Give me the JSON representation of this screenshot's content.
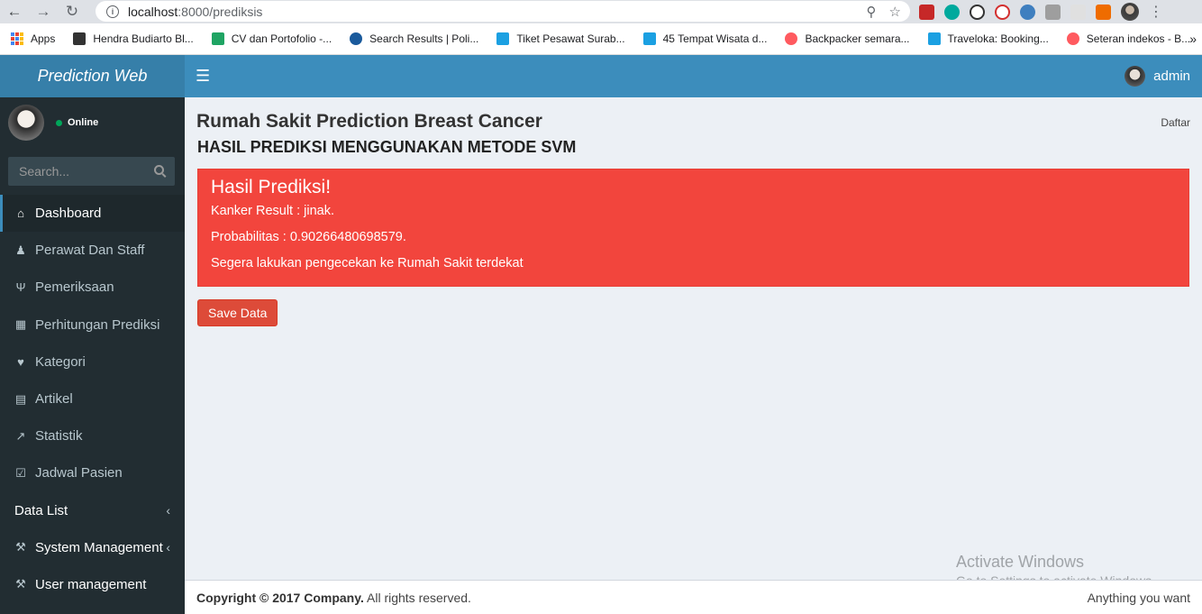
{
  "browser": {
    "url_host": "localhost",
    "url_rest": ":8000/prediksis",
    "bookmarks": [
      {
        "label": "Apps",
        "color": "#4285f4"
      },
      {
        "label": "Hendra Budiarto Bl...",
        "color": "#333333"
      },
      {
        "label": "CV dan Portofolio -...",
        "color": "#1fa463"
      },
      {
        "label": "Search Results | Poli...",
        "color": "#1a5a9c"
      },
      {
        "label": "Tiket Pesawat Surab...",
        "color": "#1ba0e2"
      },
      {
        "label": "45 Tempat Wisata d...",
        "color": "#1ba0e2"
      },
      {
        "label": "Backpacker semara...",
        "color": "#ff5a5f"
      },
      {
        "label": "Traveloka: Booking...",
        "color": "#1ba0e2"
      },
      {
        "label": "Seteran indekos - B...",
        "color": "#ff5a5f"
      }
    ],
    "more_label": "»"
  },
  "header": {
    "brand": "Prediction Web",
    "username": "admin"
  },
  "sidebar": {
    "status": "Online",
    "search_placeholder": "Search...",
    "items": [
      {
        "label": "Dashboard",
        "icon": "home-icon"
      },
      {
        "label": "Perawat Dan Staff",
        "icon": "user-icon"
      },
      {
        "label": "Pemeriksaan",
        "icon": "stethoscope-icon"
      },
      {
        "label": "Perhitungan Prediksi",
        "icon": "calculator-icon"
      },
      {
        "label": "Kategori",
        "icon": "heartbeat-icon"
      },
      {
        "label": "Artikel",
        "icon": "file-icon"
      },
      {
        "label": "Statistik",
        "icon": "line-chart-icon"
      },
      {
        "label": "Jadwal Pasien",
        "icon": "calendar-check-icon"
      },
      {
        "label": "Data List",
        "icon": ""
      },
      {
        "label": "System Management",
        "icon": "wrench-icon"
      },
      {
        "label": "User management",
        "icon": "wrench-icon"
      }
    ]
  },
  "content": {
    "title": "Rumah Sakit Prediction Breast Cancer",
    "breadcrumb": "Daftar",
    "subtitle": "HASIL PREDIKSI MENGGUNAKAN METODE SVM",
    "alert": {
      "heading": "Hasil Prediksi!",
      "result": "Kanker Result : jinak.",
      "probability": "Probabilitas : 0.90266480698579.",
      "advice": "Segera lakukan pengecekan ke Rumah Sakit terdekat",
      "color": "#f2453d"
    },
    "save_button": "Save Data"
  },
  "watermark": {
    "line1": "Activate Windows",
    "line2": "Go to Settings to activate Windows."
  },
  "footer": {
    "copyright": "Copyright © 2017 Company.",
    "rights": " All rights reserved.",
    "right_text": "Anything you want"
  }
}
